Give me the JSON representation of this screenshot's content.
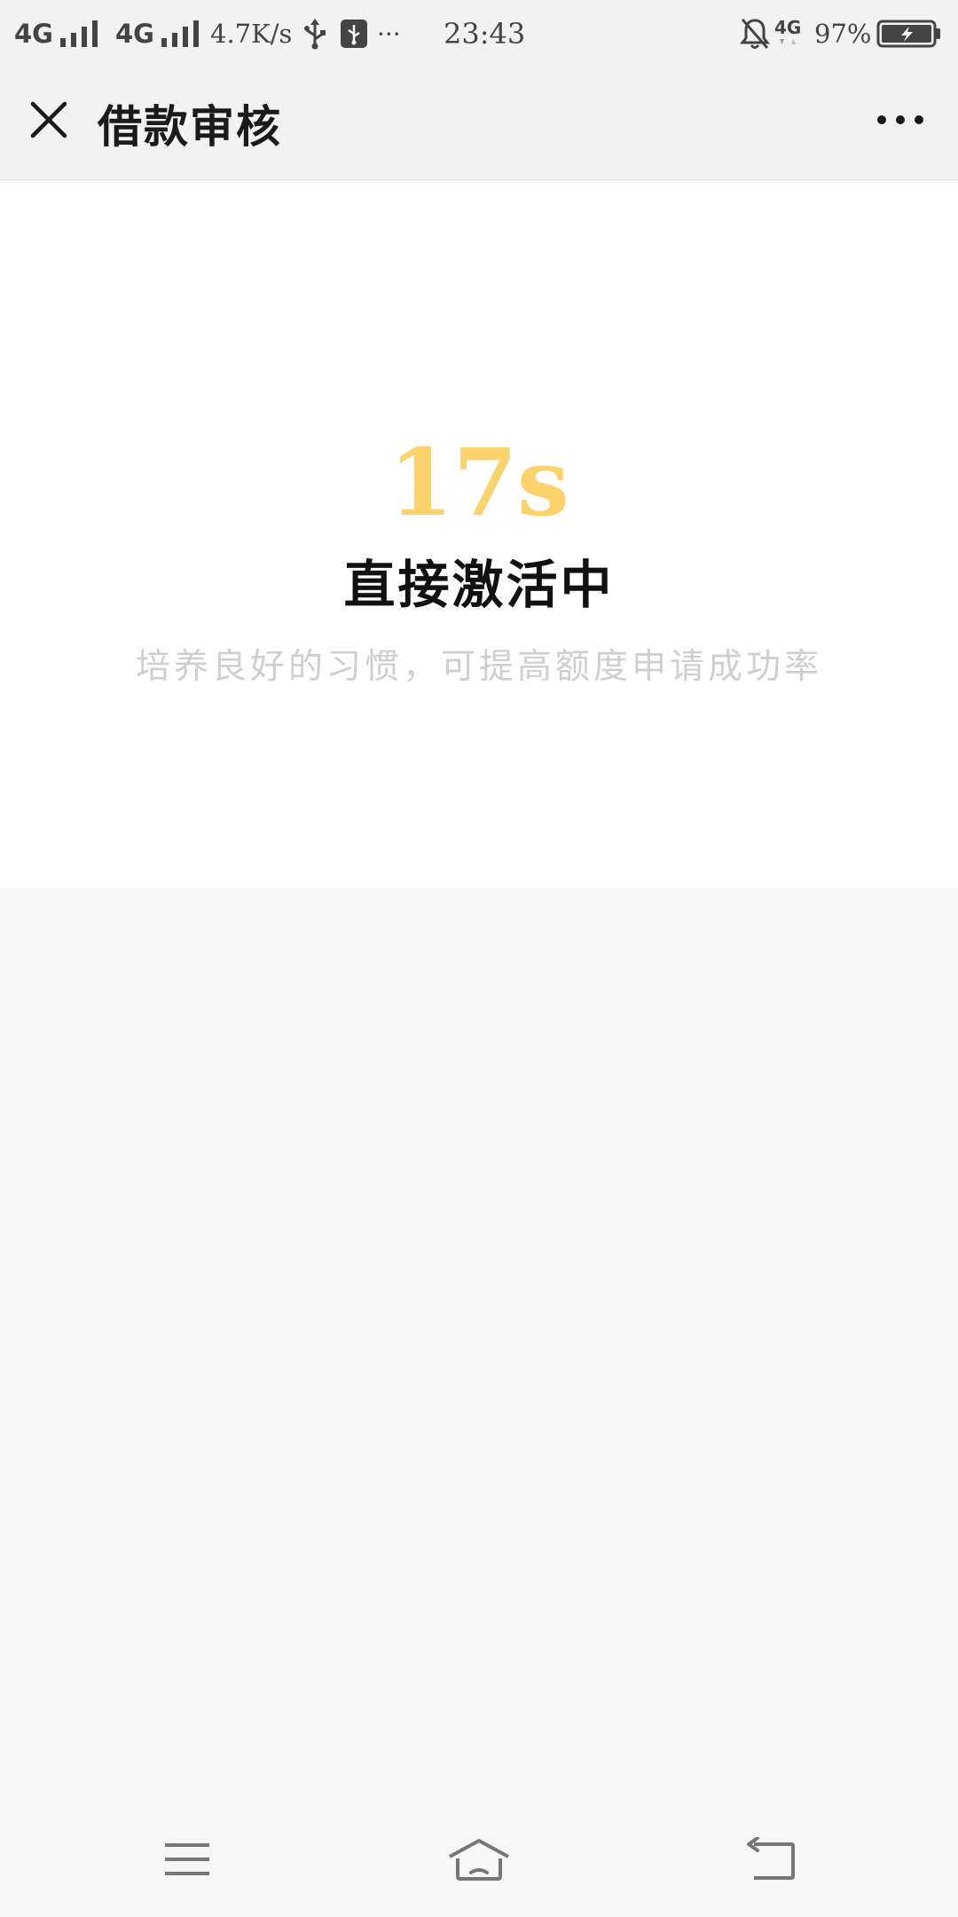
{
  "status_bar": {
    "network1": "4G",
    "network2": "4G",
    "speed": "4.7K/s",
    "more": "···",
    "time": "23:43",
    "data_badge": "4G",
    "battery": "97%"
  },
  "nav": {
    "title": "借款审核",
    "icons": {
      "close": "close-icon",
      "more": "more-icon"
    }
  },
  "main": {
    "countdown": "17s",
    "status_title": "直接激活中",
    "hint": "培养良好的习惯，可提高额度申请成功率",
    "accent_color": "#fcd26a"
  },
  "system_nav": {
    "icons": [
      "menu-icon",
      "home-icon",
      "back-icon"
    ]
  }
}
